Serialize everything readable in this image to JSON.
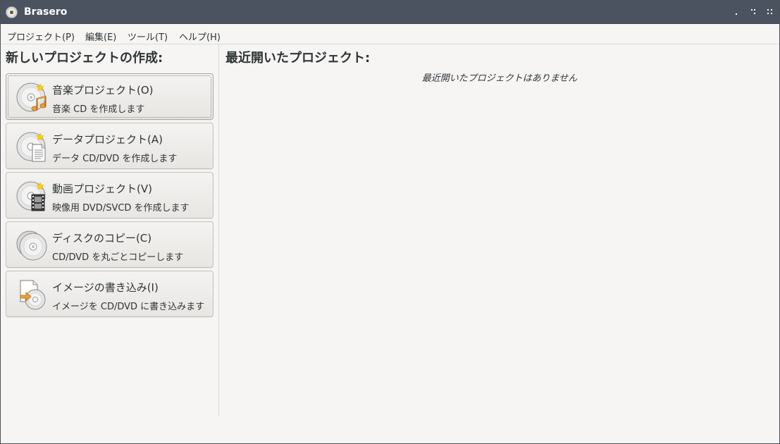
{
  "window": {
    "title": "Brasero"
  },
  "menubar": {
    "items": [
      {
        "label": "プロジェクト(P)"
      },
      {
        "label": "編集(E)"
      },
      {
        "label": "ツール(T)"
      },
      {
        "label": "ヘルプ(H)"
      }
    ]
  },
  "new_project": {
    "heading": "新しいプロジェクトの作成:",
    "buttons": [
      {
        "label": "音楽プロジェクト(O)",
        "description": "音楽 CD を作成します",
        "icon": "audio-cd-icon"
      },
      {
        "label": "データプロジェクト(A)",
        "description": "データ CD/DVD を作成します",
        "icon": "data-disc-icon"
      },
      {
        "label": "動画プロジェクト(V)",
        "description": "映像用 DVD/SVCD を作成します",
        "icon": "video-disc-icon"
      },
      {
        "label": "ディスクのコピー(C)",
        "description": "CD/DVD を丸ごとコピーします",
        "icon": "disc-copy-icon"
      },
      {
        "label": "イメージの書き込み(I)",
        "description": "イメージを CD/DVD に書き込みます",
        "icon": "image-burn-icon"
      }
    ]
  },
  "recent": {
    "heading": "最近開いたプロジェクト:",
    "empty_message": "最近開いたプロジェクトはありません"
  },
  "colors": {
    "titlebar": "#4b5360",
    "background": "#f6f5f4",
    "accent_orange": "#f0a030"
  }
}
